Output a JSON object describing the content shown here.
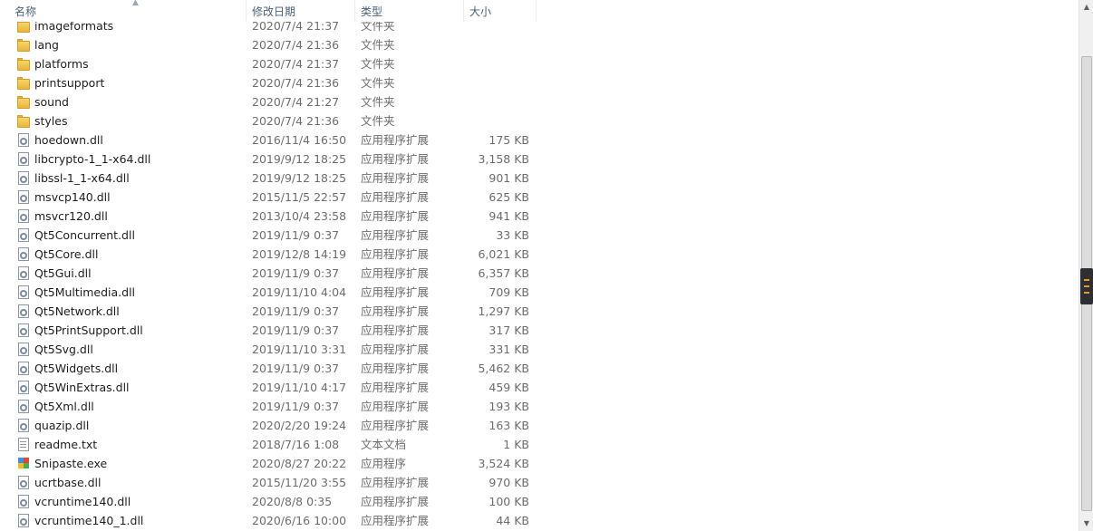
{
  "columns": {
    "name": "名称",
    "date": "修改日期",
    "type": "类型",
    "size": "大小"
  },
  "files": [
    {
      "name": "imageformats",
      "date": "2020/7/4 21:37",
      "type": "文件夹",
      "size": "",
      "icon": "folder-icon"
    },
    {
      "name": "lang",
      "date": "2020/7/4 21:36",
      "type": "文件夹",
      "size": "",
      "icon": "folder-icon"
    },
    {
      "name": "platforms",
      "date": "2020/7/4 21:37",
      "type": "文件夹",
      "size": "",
      "icon": "folder-icon"
    },
    {
      "name": "printsupport",
      "date": "2020/7/4 21:36",
      "type": "文件夹",
      "size": "",
      "icon": "folder-icon"
    },
    {
      "name": "sound",
      "date": "2020/7/4 21:27",
      "type": "文件夹",
      "size": "",
      "icon": "folder-icon"
    },
    {
      "name": "styles",
      "date": "2020/7/4 21:36",
      "type": "文件夹",
      "size": "",
      "icon": "folder-icon"
    },
    {
      "name": "hoedown.dll",
      "date": "2016/11/4 16:50",
      "type": "应用程序扩展",
      "size": "175 KB",
      "icon": "dll-file-icon"
    },
    {
      "name": "libcrypto-1_1-x64.dll",
      "date": "2019/9/12 18:25",
      "type": "应用程序扩展",
      "size": "3,158 KB",
      "icon": "dll-file-icon"
    },
    {
      "name": "libssl-1_1-x64.dll",
      "date": "2019/9/12 18:25",
      "type": "应用程序扩展",
      "size": "901 KB",
      "icon": "dll-file-icon"
    },
    {
      "name": "msvcp140.dll",
      "date": "2015/11/5 22:57",
      "type": "应用程序扩展",
      "size": "625 KB",
      "icon": "dll-file-icon"
    },
    {
      "name": "msvcr120.dll",
      "date": "2013/10/4 23:58",
      "type": "应用程序扩展",
      "size": "941 KB",
      "icon": "dll-file-icon"
    },
    {
      "name": "Qt5Concurrent.dll",
      "date": "2019/11/9 0:37",
      "type": "应用程序扩展",
      "size": "33 KB",
      "icon": "dll-file-icon"
    },
    {
      "name": "Qt5Core.dll",
      "date": "2019/12/8 14:19",
      "type": "应用程序扩展",
      "size": "6,021 KB",
      "icon": "dll-file-icon"
    },
    {
      "name": "Qt5Gui.dll",
      "date": "2019/11/9 0:37",
      "type": "应用程序扩展",
      "size": "6,357 KB",
      "icon": "dll-file-icon"
    },
    {
      "name": "Qt5Multimedia.dll",
      "date": "2019/11/10 4:04",
      "type": "应用程序扩展",
      "size": "709 KB",
      "icon": "dll-file-icon"
    },
    {
      "name": "Qt5Network.dll",
      "date": "2019/11/9 0:37",
      "type": "应用程序扩展",
      "size": "1,297 KB",
      "icon": "dll-file-icon"
    },
    {
      "name": "Qt5PrintSupport.dll",
      "date": "2019/11/9 0:37",
      "type": "应用程序扩展",
      "size": "317 KB",
      "icon": "dll-file-icon"
    },
    {
      "name": "Qt5Svg.dll",
      "date": "2019/11/10 3:31",
      "type": "应用程序扩展",
      "size": "331 KB",
      "icon": "dll-file-icon"
    },
    {
      "name": "Qt5Widgets.dll",
      "date": "2019/11/9 0:37",
      "type": "应用程序扩展",
      "size": "5,462 KB",
      "icon": "dll-file-icon"
    },
    {
      "name": "Qt5WinExtras.dll",
      "date": "2019/11/10 4:17",
      "type": "应用程序扩展",
      "size": "459 KB",
      "icon": "dll-file-icon"
    },
    {
      "name": "Qt5Xml.dll",
      "date": "2019/11/9 0:37",
      "type": "应用程序扩展",
      "size": "193 KB",
      "icon": "dll-file-icon"
    },
    {
      "name": "quazip.dll",
      "date": "2020/2/20 19:24",
      "type": "应用程序扩展",
      "size": "163 KB",
      "icon": "dll-file-icon"
    },
    {
      "name": "readme.txt",
      "date": "2018/7/16 1:08",
      "type": "文本文档",
      "size": "1 KB",
      "icon": "text-file-icon"
    },
    {
      "name": "Snipaste.exe",
      "date": "2020/8/27 20:22",
      "type": "应用程序",
      "size": "3,524 KB",
      "icon": "snipaste-app-icon"
    },
    {
      "name": "ucrtbase.dll",
      "date": "2015/11/20 3:55",
      "type": "应用程序扩展",
      "size": "970 KB",
      "icon": "dll-file-icon"
    },
    {
      "name": "vcruntime140.dll",
      "date": "2020/8/8 0:35",
      "type": "应用程序扩展",
      "size": "100 KB",
      "icon": "dll-file-icon"
    },
    {
      "name": "vcruntime140_1.dll",
      "date": "2020/6/16 10:00",
      "type": "应用程序扩展",
      "size": "44 KB",
      "icon": "dll-file-icon"
    }
  ],
  "colors": {
    "folder": "#e9b43b",
    "header_text": "#4c607a",
    "detail_text": "#6d6d6d",
    "scroll_grip": "#2d2f33",
    "scroll_grip_accent": "#e89a2a"
  }
}
